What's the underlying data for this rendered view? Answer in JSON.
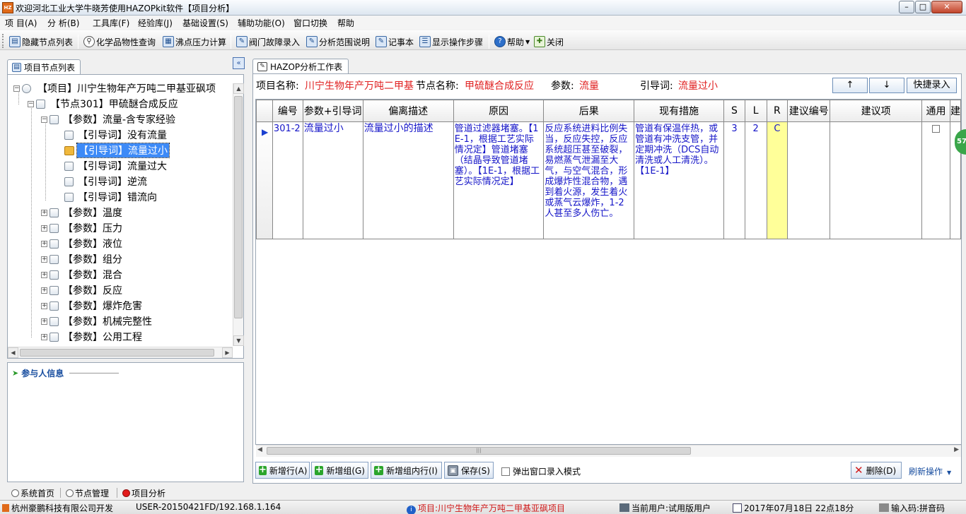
{
  "window": {
    "title": "欢迎河北工业大学牛晓芳使用HAZOPkit软件【项目分析】",
    "icon_text": "HZ"
  },
  "menu": [
    "项 目(A)",
    "分 析(B)",
    "工具库(F)",
    "经验库(J)",
    "基础设置(S)",
    "辅助功能(O)",
    "窗口切换",
    "帮助"
  ],
  "toolbar": {
    "hide_tree": "隐藏节点列表",
    "chem_query": "化学品物性查询",
    "boiling_calc": "沸点压力计算",
    "valve_fault": "阀门故障录入",
    "scope_desc": "分析范围说明",
    "notepad": "记事本",
    "show_steps": "显示操作步骤",
    "help": "帮助",
    "close": "关闭"
  },
  "tree_tab": "项目节点列表",
  "tree": {
    "project": "【项目】川宁生物年产万吨二甲基亚砜项",
    "node": "【节点301】甲硫醚合成反应",
    "param_flow": "【参数】流量-含专家经验",
    "guidewords": [
      "【引导词】没有流量",
      "【引导词】流量过小",
      "【引导词】流量过大",
      "【引导词】逆流",
      "【引导词】错流向"
    ],
    "params": [
      "【参数】温度",
      "【参数】压力",
      "【参数】液位",
      "【参数】组分",
      "【参数】混合",
      "【参数】反应",
      "【参数】爆炸危害",
      "【参数】机械完整性",
      "【参数】公用工程"
    ]
  },
  "participants_title": "参与人信息",
  "work_tab": "HAZOP分析工作表",
  "info": {
    "project_label": "项目名称:",
    "project_value": "川宁生物年产万吨二甲基",
    "node_label": "节点名称:",
    "node_value": "甲硫醚合成反应",
    "param_label": "参数:",
    "param_value": "流量",
    "guide_label": "引导词:",
    "guide_value": "流量过小"
  },
  "nav": {
    "up": "↑",
    "down": "↓",
    "quick": "快捷录入"
  },
  "grid": {
    "headers": [
      "编号",
      "参数+引导词",
      "偏离描述",
      "原因",
      "后果",
      "现有措施",
      "S",
      "L",
      "R",
      "建议编号",
      "建议项",
      "通用",
      "建"
    ],
    "row": {
      "id": "301-2",
      "param_guide": "流量过小",
      "deviation": "流量过小的描述",
      "cause": "管道过滤器堵塞。【1E-1，根据工艺实际情况定】管道堵塞（结晶导致管道堵塞）。【1E-1，根据工艺实际情况定】",
      "consequence": "反应系统进料比例失当，反应失控，反应系统超压甚至破裂，易燃蒸气泄漏至大气，与空气混合，形成爆炸性混合物，遇到着火源，发生着火或蒸气云爆炸，1-2人甚至多人伤亡。",
      "measures": "管道有保温伴热，或管道有冲洗支管，并定期冲洗（DCS自动清洗或人工清洗）。【1E-1】",
      "s": "3",
      "l": "2",
      "r": "C",
      "suggestion_id": "",
      "suggestion": ""
    }
  },
  "badge": "57",
  "bottom": {
    "add_row": "新增行(A)",
    "add_group": "新增组(G)",
    "add_group_row": "新增组内行(I)",
    "save": "保存(S)",
    "popup_mode": "弹出窗口录入模式",
    "delete": "删除(D)",
    "refresh": "刷新操作"
  },
  "nav_tabs": [
    "系统首页",
    "节点管理",
    "项目分析"
  ],
  "status": {
    "company": "杭州豪鹏科技有限公司开发",
    "user_host": "USER-20150421FD/192.168.1.164",
    "project": "项目:川宁生物年产万吨二甲基亚砜项目",
    "current_user": "当前用户:试用版用户",
    "datetime": "2017年07月18日 22点18分",
    "ime": "输入码:拼音码"
  },
  "colors": {
    "accent_blue": "#3d8af7",
    "red_text": "#e02020",
    "r_cell": "#ffff99",
    "badge": "#3aa64a"
  }
}
